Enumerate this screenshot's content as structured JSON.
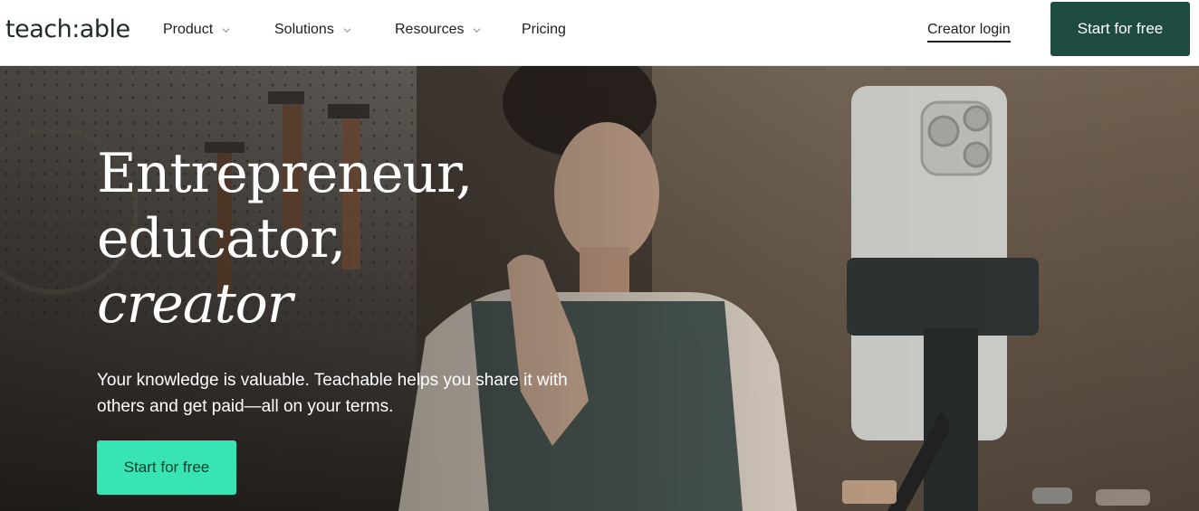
{
  "brand": {
    "logo_text": "teach:able"
  },
  "nav": {
    "items": [
      {
        "label": "Product",
        "has_dropdown": true
      },
      {
        "label": "Solutions",
        "has_dropdown": true
      },
      {
        "label": "Resources",
        "has_dropdown": true
      },
      {
        "label": "Pricing",
        "has_dropdown": false
      }
    ],
    "login_label": "Creator login",
    "cta_label": "Start for free"
  },
  "hero": {
    "headline_lines": [
      "Entrepreneur,",
      "educator,",
      "creator"
    ],
    "subtext": "Your knowledge is valuable. Teachable helps you share it with others and get paid—all on your terms.",
    "cta_label": "Start for free"
  },
  "colors": {
    "primary_dark": "#1d4b41",
    "accent_mint": "#38e4b4",
    "text_dark": "#1f1f1f"
  },
  "icons": {
    "dropdown": "chevron-down-icon"
  }
}
